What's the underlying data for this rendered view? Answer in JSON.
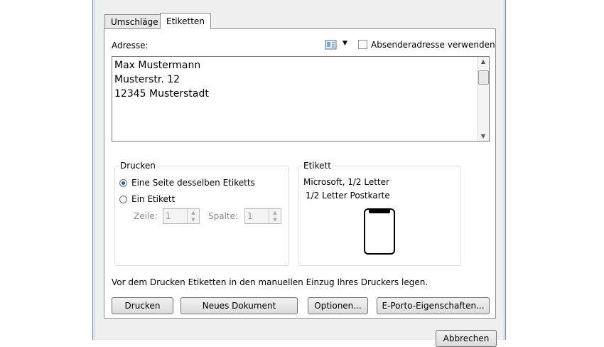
{
  "tabs": [
    {
      "label": "Umschläge",
      "active": false
    },
    {
      "label": "Etiketten",
      "active": true
    }
  ],
  "address": {
    "label": "Adresse:",
    "lines": [
      "Max Mustermann",
      "Musterstr. 12",
      "12345 Musterstadt"
    ],
    "use_sender_label": "Absenderadresse verwenden",
    "use_sender_checked": false,
    "addressbook_icon": "address-book-icon"
  },
  "print_group": {
    "title": "Drucken",
    "option_full_page": "Eine Seite desselben Etiketts",
    "option_single": "Ein Etikett",
    "selected": "full_page",
    "row_label": "Zeile:",
    "row_value": "1",
    "column_label": "Spalte:",
    "column_value": "1"
  },
  "label_group": {
    "title": "Etikett",
    "vendor": "Microsoft, 1/2 Letter",
    "product": "1/2 Letter Postkarte"
  },
  "hint": "Vor dem Drucken Etiketten in den manuellen Einzug Ihres Druckers legen.",
  "buttons": {
    "print": "Drucken",
    "new_document": "Neues Dokument",
    "options": "Optionen...",
    "eporto": "E-Porto-Eigenschaften...",
    "cancel": "Abbrechen"
  }
}
